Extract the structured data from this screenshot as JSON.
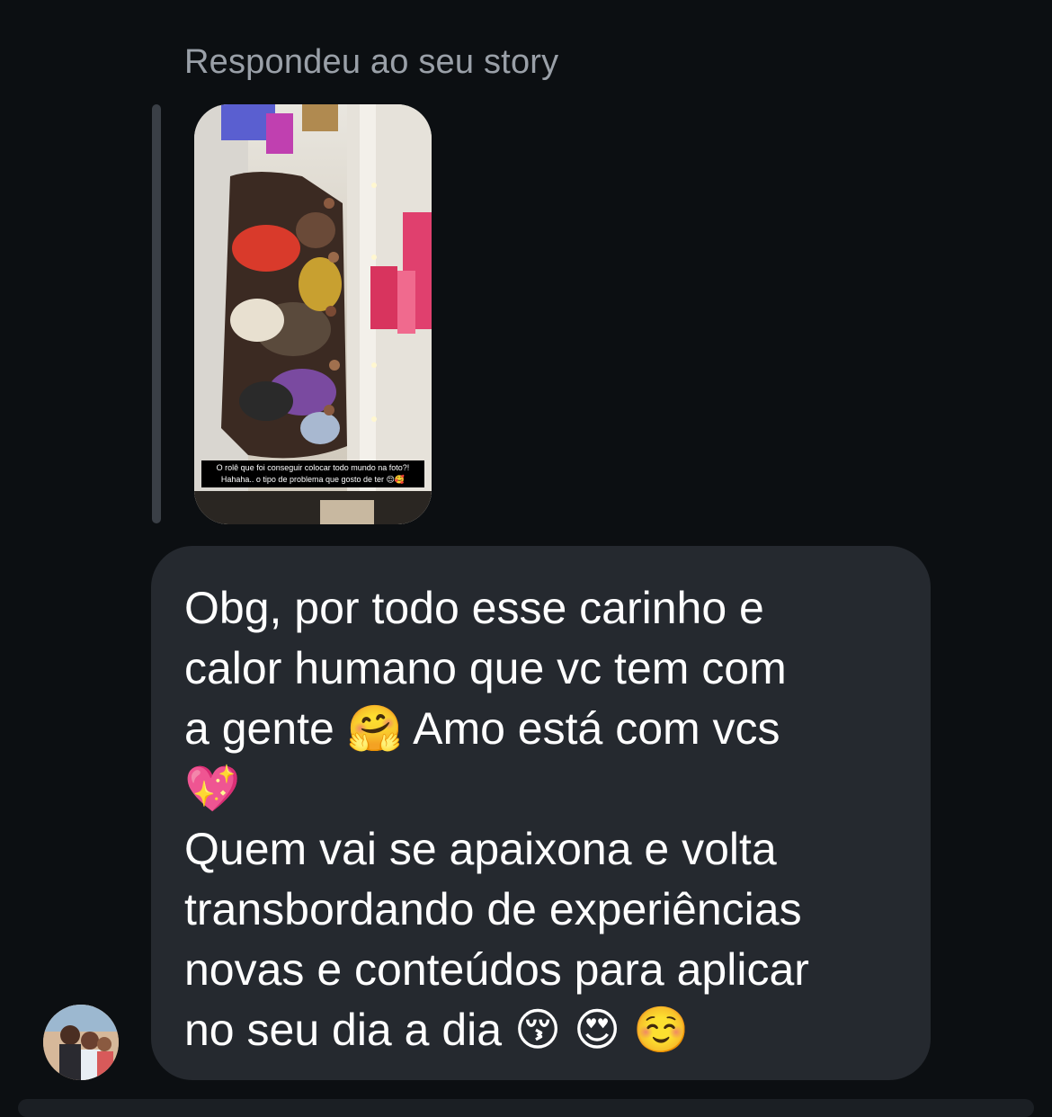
{
  "reply_header": {
    "caption": "Respondeu ao seu story"
  },
  "story": {
    "caption": "O rolê que foi conseguir colocar todo mundo na foto?! Hahaha.. o tipo de problema que gosto de ter 😌🥰",
    "icon": "story-photo"
  },
  "message": {
    "text": "Obg, por todo esse carinho e\ncalor humano que vc tem com\na gente 🤗 Amo está com vcs\n💖\nQuem vai se apaixona e volta\ntransbordando de experiências\nnovas e conteúdos para aplicar\nno seu dia a dia 😚 😍 ☺️"
  },
  "sender": {
    "avatar_icon": "profile-avatar"
  },
  "colors": {
    "background": "#0c0f12",
    "bubble": "#25292f",
    "caption": "#9aa0a8",
    "reply_bar": "#3a3f46"
  }
}
